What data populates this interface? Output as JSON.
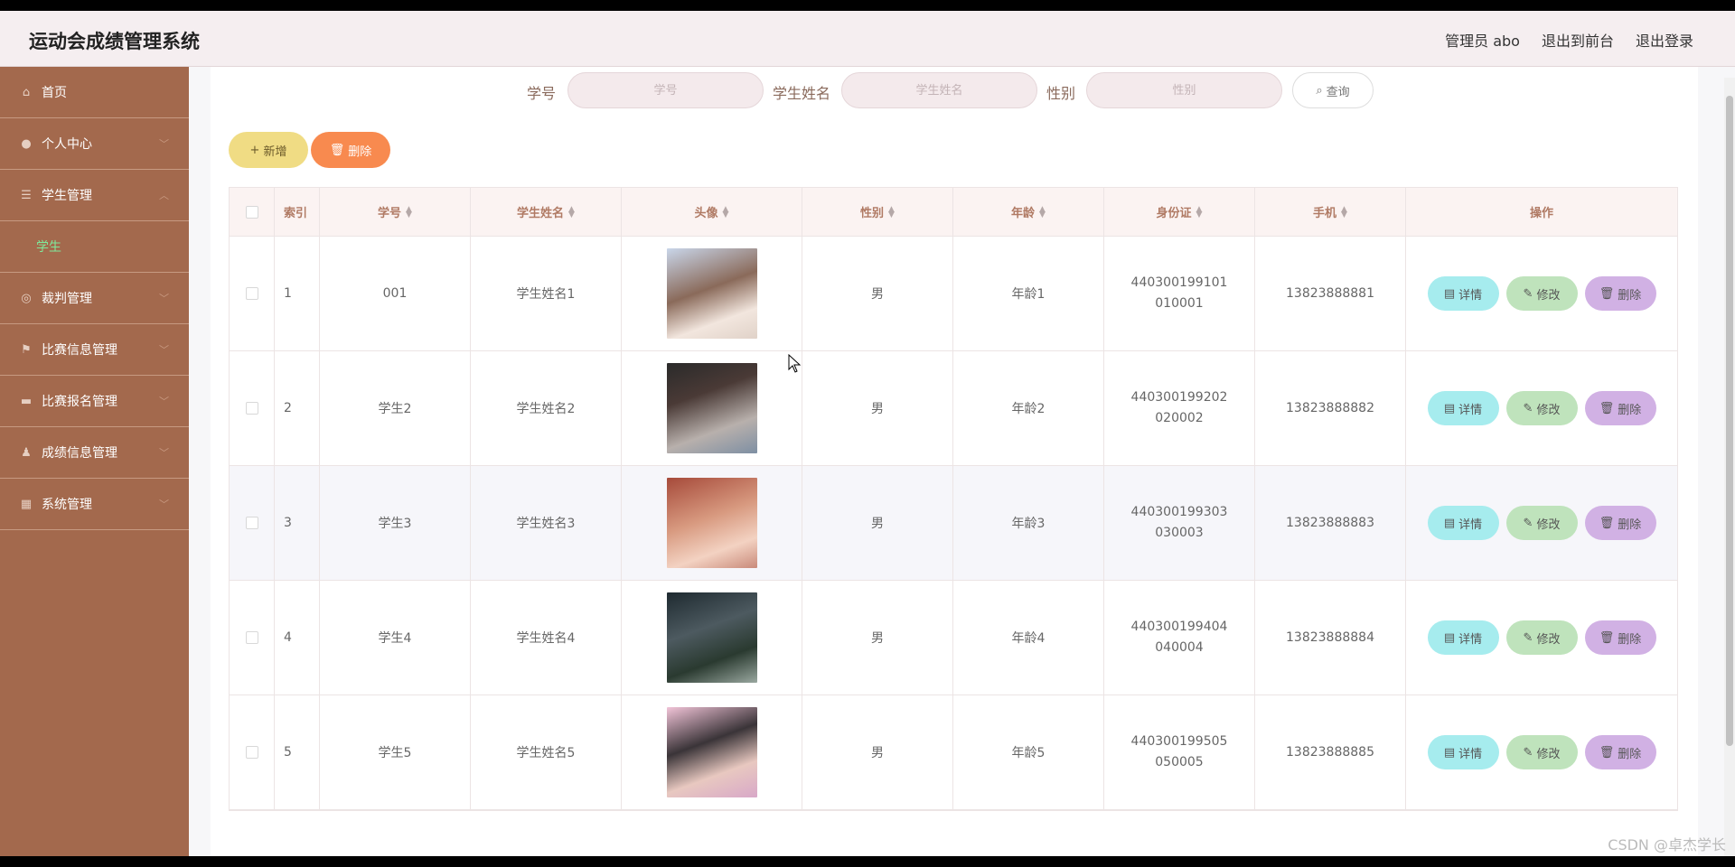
{
  "header": {
    "title": "运动会成绩管理系统",
    "user": "管理员 abo",
    "to_front": "退出到前台",
    "logout": "退出登录"
  },
  "sidebar": {
    "items": [
      {
        "label": "首页",
        "icon": "home-icon"
      },
      {
        "label": "个人中心",
        "icon": "user-icon"
      },
      {
        "label": "学生管理",
        "icon": "list-icon",
        "expanded": true,
        "sub": "学生"
      },
      {
        "label": "裁判管理",
        "icon": "compass-icon"
      },
      {
        "label": "比赛信息管理",
        "icon": "flag-icon"
      },
      {
        "label": "比赛报名管理",
        "icon": "monitor-icon"
      },
      {
        "label": "成绩信息管理",
        "icon": "person-icon"
      },
      {
        "label": "系统管理",
        "icon": "server-icon"
      }
    ]
  },
  "search": {
    "student_no_label": "学号",
    "student_no_placeholder": "学号",
    "student_name_label": "学生姓名",
    "student_name_placeholder": "学生姓名",
    "gender_label": "性别",
    "gender_placeholder": "性别",
    "query_label": "查询"
  },
  "actions": {
    "add_label": "新增",
    "delete_label": "删除"
  },
  "table": {
    "columns": [
      "索引",
      "学号",
      "学生姓名",
      "头像",
      "性别",
      "年龄",
      "身份证",
      "手机",
      "操作"
    ],
    "rows": [
      {
        "index": "1",
        "no": "001",
        "name": "学生姓名1",
        "gender": "男",
        "age": "年龄1",
        "id": "440300199101010001",
        "phone": "13823888881"
      },
      {
        "index": "2",
        "no": "学生2",
        "name": "学生姓名2",
        "gender": "男",
        "age": "年龄2",
        "id": "440300199202020002",
        "phone": "13823888882"
      },
      {
        "index": "3",
        "no": "学生3",
        "name": "学生姓名3",
        "gender": "男",
        "age": "年龄3",
        "id": "440300199303030003",
        "phone": "13823888883"
      },
      {
        "index": "4",
        "no": "学生4",
        "name": "学生姓名4",
        "gender": "男",
        "age": "年龄4",
        "id": "440300199404040004",
        "phone": "13823888884"
      },
      {
        "index": "5",
        "no": "学生5",
        "name": "学生姓名5",
        "gender": "男",
        "age": "年龄5",
        "id": "440300199505050005",
        "phone": "13823888885"
      }
    ],
    "op_detail": "详情",
    "op_edit": "修改",
    "op_delete": "删除"
  },
  "watermark": "CSDN @卓杰学长",
  "colors": {
    "sidebar": "#a3694d",
    "header": "#f5eef0",
    "accent_sub": "#7fe89a",
    "add": "#f0dc84",
    "delete": "#f88a4f",
    "detail": "#a6ecee",
    "edit": "#bfe3bc",
    "remove": "#d1b1e4"
  }
}
